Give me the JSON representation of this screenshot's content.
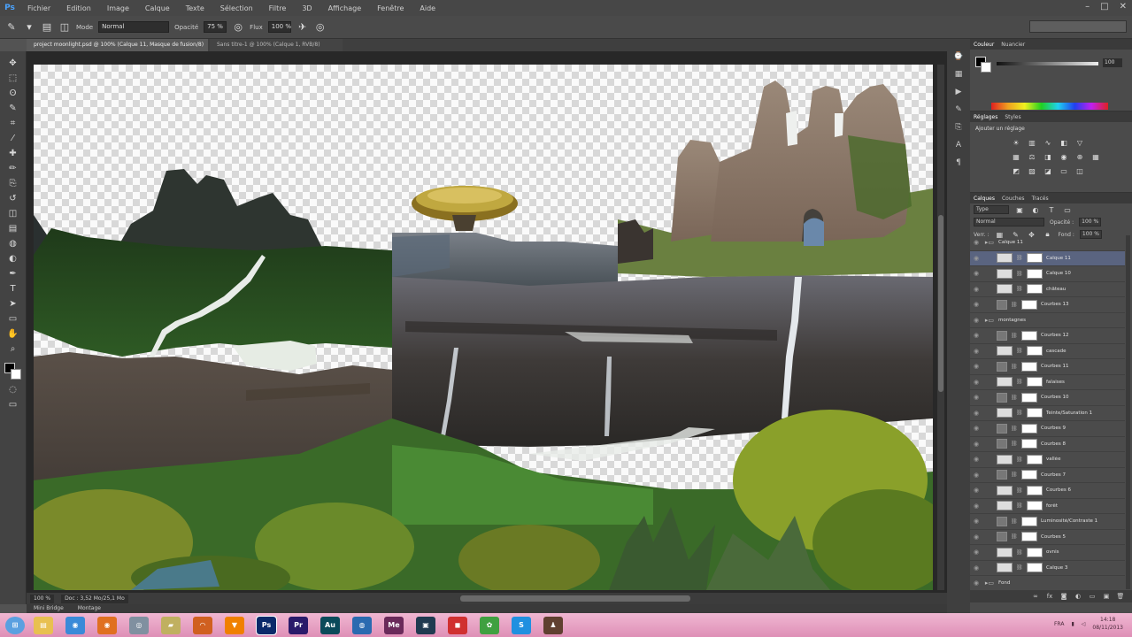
{
  "app": {
    "logo": "Ps"
  },
  "menu": [
    "Fichier",
    "Edition",
    "Image",
    "Calque",
    "Texte",
    "Sélection",
    "Filtre",
    "3D",
    "Affichage",
    "Fenêtre",
    "Aide"
  ],
  "window_controls": {
    "minimize": "–",
    "maximize": "□",
    "close": "✕"
  },
  "options_bar": {
    "mode_label": "Mode",
    "mode_value": "Normal",
    "opacity_label": "Opacité",
    "opacity_value": "75 %",
    "flow_label": "Flux",
    "flow_value": "100 %"
  },
  "tabs": {
    "active": "project moonlight.psd @ 100% (Calque 11, Masque de fusion/8)",
    "inactive": "Sans titre-1 @ 100% (Calque 1, RVB/8)"
  },
  "tools": [
    "move-tool",
    "marquee-tool",
    "lasso-tool",
    "quick-select-tool",
    "crop-tool",
    "eyedropper-tool",
    "healing-tool",
    "brush-tool",
    "clone-stamp-tool",
    "history-brush-tool",
    "eraser-tool",
    "gradient-tool",
    "blur-tool",
    "dodge-tool",
    "pen-tool",
    "type-tool",
    "path-select-tool",
    "shape-tool",
    "hand-tool",
    "zoom-tool"
  ],
  "tool_glyphs": [
    "✥",
    "⬚",
    "ʘ",
    "✎",
    "⌗",
    "⁄",
    "✚",
    "✏",
    "⎘",
    "↺",
    "◫",
    "▤",
    "◍",
    "◐",
    "✒",
    "T",
    "➤",
    "▭",
    "✋",
    "⌕"
  ],
  "status": {
    "zoom": "100 %",
    "doc_size": "Doc : 3,52 Mo/25,1 Mo"
  },
  "bottom_tabs": [
    "Mini Bridge",
    "Montage"
  ],
  "color_panel": {
    "tabs": [
      "Couleur",
      "Nuancier"
    ],
    "value": "100"
  },
  "adjustments": {
    "tabs": [
      "Réglages",
      "Styles"
    ],
    "title": "Ajouter un réglage"
  },
  "layers": {
    "tabs": [
      "Calques",
      "Couches",
      "Tracés"
    ],
    "kind_filter": "Type",
    "blend_mode": "Normal",
    "opacity_label": "Opacité :",
    "opacity_value": "100 %",
    "lock_label": "Verr. :",
    "fill_label": "Fond :",
    "fill_value": "100 %",
    "rows": [
      {
        "name": "Calque 11",
        "type": "group"
      },
      {
        "name": "Calque 11",
        "type": "layer",
        "selected": true
      },
      {
        "name": "Calque 10",
        "type": "layer"
      },
      {
        "name": "château",
        "type": "layer"
      },
      {
        "name": "Courbes 13",
        "type": "adj"
      },
      {
        "name": "montagnes",
        "type": "group"
      },
      {
        "name": "Courbes 12",
        "type": "adj"
      },
      {
        "name": "cascade",
        "type": "layer"
      },
      {
        "name": "Courbes 11",
        "type": "adj"
      },
      {
        "name": "falaises",
        "type": "layer"
      },
      {
        "name": "Courbes 10",
        "type": "adj"
      },
      {
        "name": "Teinte/Saturation 1",
        "type": "layer"
      },
      {
        "name": "Courbes 9",
        "type": "adj"
      },
      {
        "name": "Courbes 8",
        "type": "adj"
      },
      {
        "name": "vallée",
        "type": "layer"
      },
      {
        "name": "Courbes 7",
        "type": "adj"
      },
      {
        "name": "Courbes 6",
        "type": "layer"
      },
      {
        "name": "forêt",
        "type": "layer"
      },
      {
        "name": "Luminosité/Contraste 1",
        "type": "adj"
      },
      {
        "name": "Courbes 5",
        "type": "adj"
      },
      {
        "name": "ovnis",
        "type": "layer"
      },
      {
        "name": "Calque 3",
        "type": "layer"
      },
      {
        "name": "Fond",
        "type": "group"
      }
    ]
  },
  "taskbar": {
    "icons": [
      {
        "name": "explorer",
        "label": "▤",
        "color": "#e8c050"
      },
      {
        "name": "chrome",
        "label": "◉",
        "color": "#3a8ad8"
      },
      {
        "name": "firefox",
        "label": "◉",
        "color": "#e07020"
      },
      {
        "name": "disk",
        "label": "◎",
        "color": "#8090a0"
      },
      {
        "name": "folder",
        "label": "▰",
        "color": "#c0b060"
      },
      {
        "name": "headphones",
        "label": "◠",
        "color": "#d06020"
      },
      {
        "name": "vlc",
        "label": "▼",
        "color": "#f08000"
      },
      {
        "name": "photoshop",
        "label": "Ps",
        "color": "#0a2a6a",
        "active": true
      },
      {
        "name": "premiere",
        "label": "Pr",
        "color": "#2a1a6a"
      },
      {
        "name": "audition",
        "label": "Au",
        "color": "#0a4a5a"
      },
      {
        "name": "thunderbird",
        "label": "◍",
        "color": "#2a6ab0"
      },
      {
        "name": "media-encoder",
        "label": "Me",
        "color": "#6a2a5a"
      },
      {
        "name": "recorder",
        "label": "▣",
        "color": "#203a50"
      },
      {
        "name": "screen-tool",
        "label": "◼",
        "color": "#d03030"
      },
      {
        "name": "palette",
        "label": "✿",
        "color": "#40a040"
      },
      {
        "name": "skype",
        "label": "S",
        "color": "#2090e0"
      },
      {
        "name": "figure",
        "label": "♟",
        "color": "#604030"
      }
    ],
    "tray_language": "FRA",
    "time": "14:18",
    "date": "08/11/2013"
  }
}
